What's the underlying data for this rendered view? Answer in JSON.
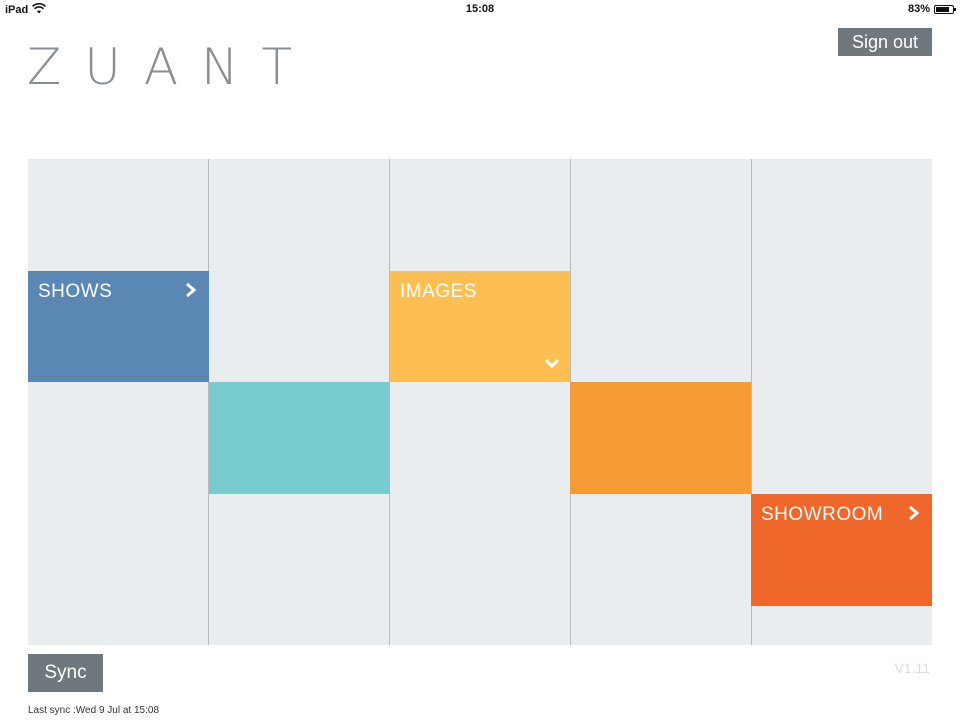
{
  "status_bar": {
    "device": "iPad",
    "time": "15:08",
    "battery": "83%",
    "battery_level": 0.83
  },
  "logo": "ZUANT",
  "header": {
    "sign_out_label": "Sign out"
  },
  "tiles": {
    "shows": {
      "label": "SHOWS",
      "color": "#5b87b5"
    },
    "teal": {
      "color": "#78ccce"
    },
    "images": {
      "label": "IMAGES",
      "color": "#fdbf52"
    },
    "orange": {
      "color": "#f59b33"
    },
    "showroom": {
      "label": "SHOWROOM",
      "color": "#f0672b"
    }
  },
  "footer": {
    "sync_label": "Sync",
    "version": "V1.11",
    "last_sync": "Last sync :Wed 9 Jul at 15:08"
  },
  "icons": {
    "wifi": "wifi-icon",
    "battery": "battery-icon",
    "chevron_right": "chevron-right-icon",
    "chevron_down": "chevron-down-icon"
  }
}
